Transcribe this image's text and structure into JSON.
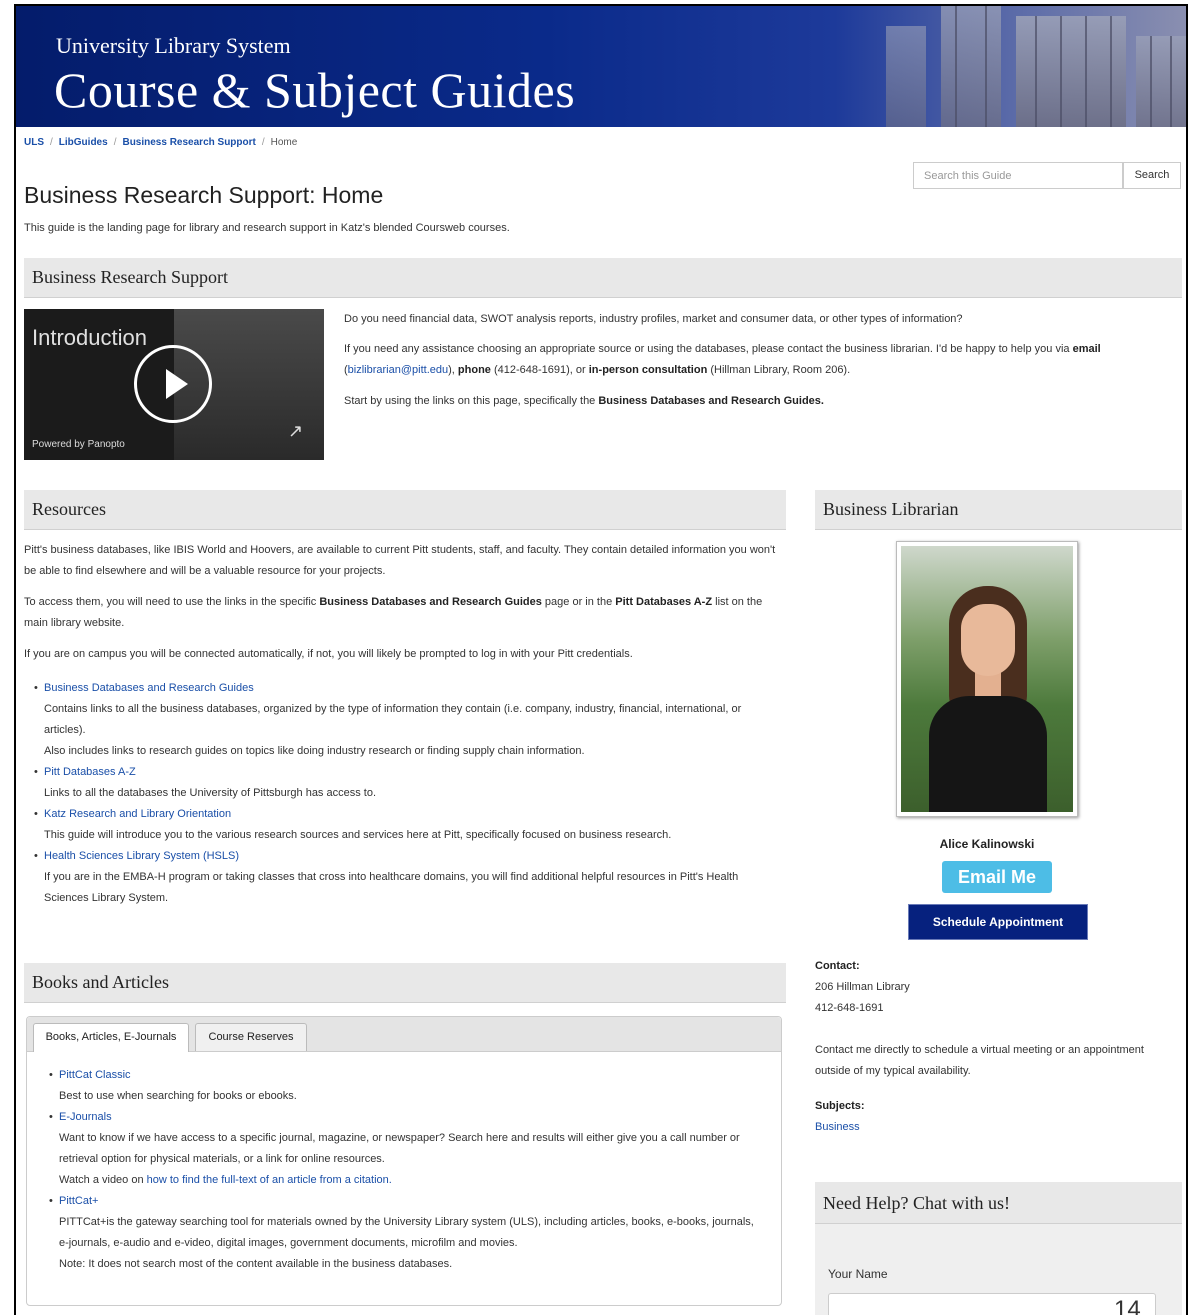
{
  "banner": {
    "subtitle": "University Library System",
    "title": "Course & Subject Guides"
  },
  "breadcrumb": {
    "items": [
      "ULS",
      "LibGuides",
      "Business Research Support"
    ],
    "current": "Home",
    "separator": "/"
  },
  "search": {
    "placeholder": "Search this Guide",
    "button": "Search"
  },
  "page": {
    "title": "Business Research Support: Home",
    "description": "This guide is the landing page for library and research support in Katz's blended Coursweb courses."
  },
  "intro": {
    "header": "Business Research Support",
    "video": {
      "title": "Introduction",
      "powered_by": "Powered by Panopto",
      "expand_icon": "↗"
    },
    "p1": "Do you need financial data, SWOT analysis reports, industry profiles, market and consumer data, or other types of information?",
    "p2_a": "If you need any assistance choosing an appropriate source or using the databases, please contact the business librarian. I'd be happy to help you via ",
    "p2_email_label": "email",
    "p2_b": "(",
    "p2_email": "bizlibrarian@pitt.edu",
    "p2_c": "), ",
    "p2_phone_label": "phone",
    "p2_d": " (412-648-1691), or ",
    "p2_consult_label": "in-person consultation",
    "p2_e": " (Hillman Library, Room 206).",
    "p3_a": "Start by using the links on this page, specifically the ",
    "p3_b": "Business Databases and Research Guides."
  },
  "resources": {
    "header": "Resources",
    "p1": "Pitt's business databases, like IBIS World and Hoovers, are available to current Pitt students, staff, and faculty. They contain detailed information you won't",
    "p1b": "be able to find elsewhere and will be a valuable resource for your projects.",
    "p2_a": "To access them, you will need to use the links in the specific ",
    "p2_b": "Business Databases and Research Guides",
    "p2_c": " page or in the ",
    "p2_d": "Pitt Databases A-Z",
    "p2_e": " list on the",
    "p2_f": "main library website.",
    "p3": "If you are on campus you will be connected automatically, if not, you will likely be prompted to log in with your Pitt credentials.",
    "items": [
      {
        "link": "Business Databases and Research Guides",
        "l1": "Contains links to all the business databases, organized by the type of information they contain (i.e. company, industry, financial, international, or",
        "l2": "articles).",
        "l3": "Also includes links to research guides on topics like doing industry research or finding supply chain information."
      },
      {
        "link": "Pitt Databases A-Z",
        "l1": "Links to all the databases the University of Pittsburgh has access to."
      },
      {
        "link": "Katz Research and Library Orientation",
        "l1": "This guide will introduce you to the various research sources and services here at Pitt, specifically focused on business research."
      },
      {
        "link": "Health Sciences Library System (HSLS)",
        "l1": "If you are in the EMBA-H program or taking classes that cross into healthcare domains, you will find additional helpful resources in Pitt's Health",
        "l2": "Sciences Library System."
      }
    ]
  },
  "books": {
    "header": "Books and Articles",
    "tabs": [
      "Books, Articles, E-Journals",
      "Course Reserves"
    ],
    "items": [
      {
        "link": "PittCat Classic",
        "l1": "Best to use when searching for books or ebooks."
      },
      {
        "link": "E-Journals",
        "l1": "Want to know if we have access to a specific journal, magazine, or newspaper? Search here and results will either give you a call number or",
        "l2": "retrieval option for physical materials, or a link for online resources.",
        "l3_a": "Watch a video on ",
        "l3_link": "how to find the full-text of an article from a citation."
      },
      {
        "link": "PittCat+",
        "l1": "PITTCat+is the gateway searching tool for materials owned by the University Library system (ULS), including articles, books, e-books, journals,",
        "l2": "e-journals, e-audio and e-video, digital images, government documents, microfilm and movies.",
        "l3": "Note: It does not search most of the content available in the business databases."
      }
    ]
  },
  "librarian": {
    "header": "Business Librarian",
    "name": "Alice Kalinowski",
    "email_button": "Email Me",
    "schedule_button": "Schedule Appointment",
    "contact_label": "Contact:",
    "contact_l1": "206 Hillman Library",
    "contact_l2": "412-648-1691",
    "note_l1": "Contact me directly to schedule a virtual meeting or an appointment",
    "note_l2": "outside of my typical availability.",
    "subjects_label": "Subjects:",
    "subject": "Business"
  },
  "chat": {
    "header": "Need Help? Chat with us!",
    "name_label": "Your Name"
  },
  "slide_number": "14",
  "colors": {
    "banner": "#0a2a8a",
    "link": "#1a4fa8",
    "email_button": "#4dbde6",
    "schedule_button": "#06217e"
  }
}
